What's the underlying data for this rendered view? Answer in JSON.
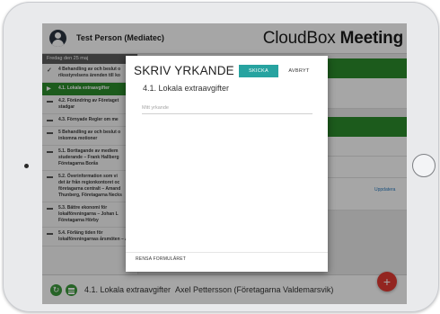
{
  "header": {
    "user_name": "Test Person (Mediatec)",
    "brand_light": "CloudBox ",
    "brand_bold": "Meeting"
  },
  "agenda": {
    "date_label": "Fredag den 25 maj",
    "items": [
      {
        "mark": "check",
        "lines": [
          "4 Behandling av och beslut o",
          "riksstyrelsens ärenden till ko"
        ]
      },
      {
        "mark": "play",
        "lines": [
          "4.1. Lokala extraavgifter"
        ],
        "active": true
      },
      {
        "mark": "dash",
        "lines": [
          "4.2. Förändring av Företaget",
          "stadgar"
        ]
      },
      {
        "mark": "dash",
        "lines": [
          "4.3. Förnyade Regler om me"
        ]
      },
      {
        "mark": "dash",
        "lines": [
          "5 Behandling av och beslut o",
          "inkomna motioner"
        ]
      },
      {
        "mark": "dash",
        "lines": [
          "5.1. Borttagande av mediem",
          "studerande – Frank Hallberg",
          "Företagarna Borås"
        ]
      },
      {
        "mark": "dash",
        "lines": [
          "5.2. Överinformation som vi",
          "det är från regionkontoret oc",
          "företagarna centralt – Amand",
          "Thunberg, Företagarna Necks"
        ]
      },
      {
        "mark": "dash",
        "lines": [
          "5.3. Bättre ekonomi för",
          "lokalföreningarna – Johan L",
          "Företagarna Hörby"
        ]
      },
      {
        "mark": "dash",
        "lines": [
          "5.4. Förläng tiden för",
          "lokalföreningarnas årsmöten – Anna"
        ]
      }
    ]
  },
  "content": {
    "update_label": "Uppdatera"
  },
  "footer": {
    "current_item": "4.1. Lokala extraavgifter",
    "speaker": "Axel Pettersson (Företagarna Valdemarsvik)",
    "add_label": "+"
  },
  "modal": {
    "title": "SKRIV YRKANDE",
    "send_label": "SKICKA",
    "cancel_label": "AVBRYT",
    "subtitle": "4.1. Lokala extraavgifter",
    "input_value": "",
    "input_placeholder": "Mitt yrkande",
    "clear_label": "RENSA FORMULÄRET"
  },
  "colors": {
    "accent_green": "#2c8c2c",
    "send_teal": "#27a3a0",
    "fab_red": "#e23a32"
  }
}
